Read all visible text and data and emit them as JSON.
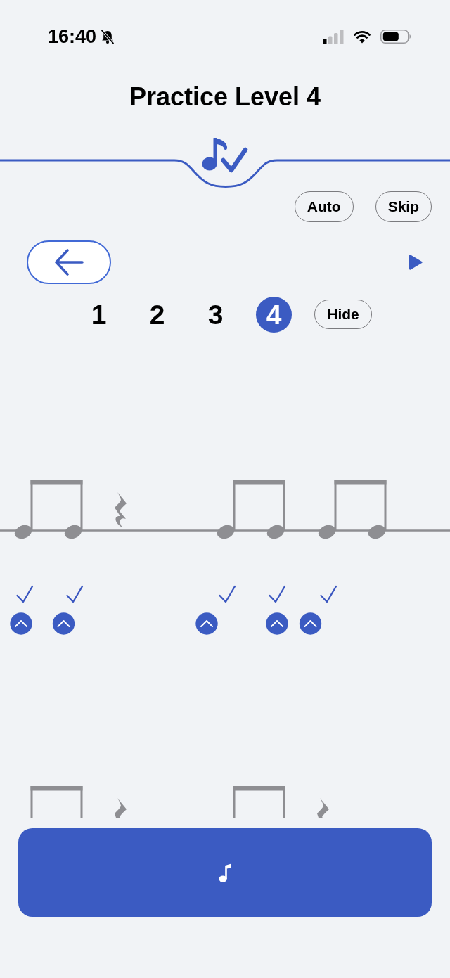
{
  "status_bar": {
    "time": "16:40"
  },
  "title": "Practice Level 4",
  "toolbar": {
    "buttons": [
      {
        "label": "Auto"
      },
      {
        "label": "Skip"
      }
    ]
  },
  "levels": {
    "items": [
      {
        "label": "1",
        "selected": false
      },
      {
        "label": "2",
        "selected": false
      },
      {
        "label": "3",
        "selected": false
      },
      {
        "label": "4",
        "selected": true
      }
    ],
    "hide_button": {
      "label": "Hide"
    }
  },
  "staff_rows": [
    {
      "cut_off": false,
      "beats": [
        {
          "kind": "beamed-pair",
          "notes": [
            {
              "checked": true,
              "tapped": true
            },
            {
              "checked": true,
              "tapped": true
            }
          ]
        },
        {
          "kind": "rest"
        },
        {
          "kind": "beamed-pair",
          "notes": [
            {
              "checked": true,
              "tapped": true
            },
            {
              "checked": true,
              "tapped": true
            }
          ]
        },
        {
          "kind": "beamed-pair",
          "notes": [
            {
              "checked": true,
              "tapped": true
            },
            {
              "checked": false,
              "tapped": false
            }
          ]
        }
      ]
    },
    {
      "cut_off": true,
      "beats": [
        {
          "kind": "beamed-pair"
        },
        {
          "kind": "rest"
        },
        {
          "kind": "beamed-pair"
        },
        {
          "kind": "rest"
        }
      ]
    }
  ]
}
